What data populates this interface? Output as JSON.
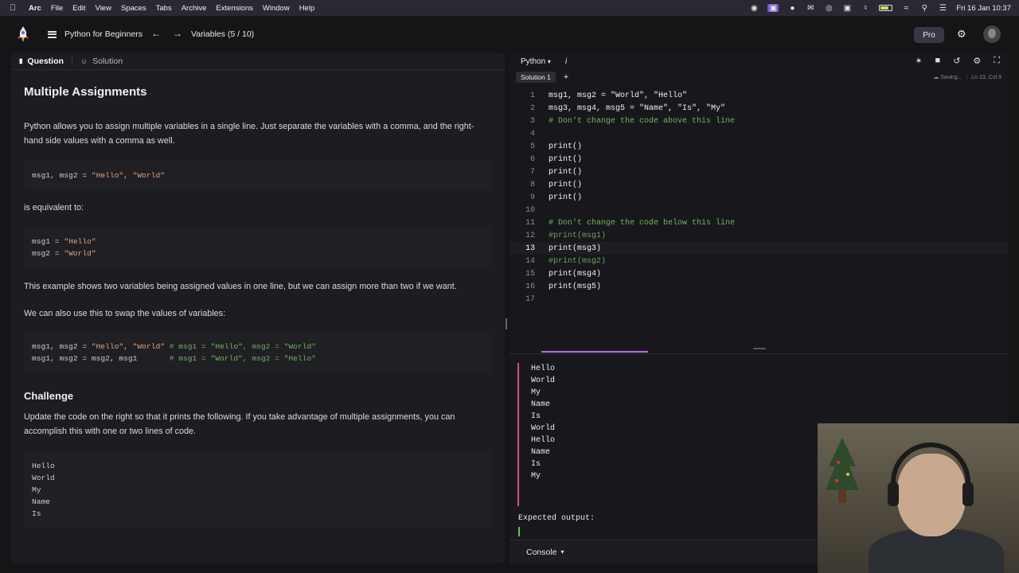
{
  "menubar": {
    "app": "Arc",
    "items": [
      "File",
      "Edit",
      "View",
      "Spaces",
      "Tabs",
      "Archive",
      "Extensions",
      "Window",
      "Help"
    ],
    "clock": "Fri 16 Jan  10:37"
  },
  "topbar": {
    "course": "Python for Beginners",
    "lesson": "Variables (5 / 10)",
    "pro": "Pro"
  },
  "left": {
    "tabs": {
      "question": "Question",
      "solution": "Solution"
    },
    "title": "Multiple Assignments",
    "intro": "Python allows you to assign multiple variables in a single line. Just separate the variables with a comma, and the right-hand side values with a comma as well.",
    "code1": {
      "pre": "msg1, msg2 = ",
      "s1": "\"Hello\"",
      "sep": ", ",
      "s2": "\"World\""
    },
    "equiv": "is equivalent to:",
    "code2": [
      {
        "pre": "msg1 = ",
        "s": "\"Hello\""
      },
      {
        "pre": "msg2 = ",
        "s": "\"World\""
      }
    ],
    "example": "This example shows two variables being assigned values in one line, but we can assign more than two if we want.",
    "swap": "We can also use this to swap the values of variables:",
    "code3": [
      {
        "pre": "msg1, msg2 = ",
        "s1": "\"Hello\"",
        "sep": ", ",
        "s2": "\"World\"",
        "cm": " # msg1 = \"Hello\", msg2 = \"World\""
      },
      {
        "pre": "msg1, msg2 = msg2, msg1      ",
        "cm": " # msg1 = \"World\", msg2 = \"Hello\""
      }
    ],
    "challenge_title": "Challenge",
    "challenge": "Update the code on the right so that it prints the following. If you take advantage of multiple assignments, you can accomplish this with one or two lines of code.",
    "expected_lines": [
      "Hello",
      "World",
      "My",
      "Name",
      "Is"
    ]
  },
  "right": {
    "language": "Python",
    "info": "i",
    "solution_tab": "Solution 1",
    "add": "+",
    "saving": "Saving...",
    "cursor": "Ln 13, Col 9",
    "code_lines": [
      {
        "n": "1",
        "t": "msg1, msg2 = \"World\", \"Hello\"",
        "k": "code"
      },
      {
        "n": "2",
        "t": "msg3, msg4, msg5 = \"Name\", \"Is\", \"My\"",
        "k": "code"
      },
      {
        "n": "3",
        "t": "# Don't change the code above this line",
        "k": "cm"
      },
      {
        "n": "4",
        "t": "",
        "k": "code"
      },
      {
        "n": "5",
        "t": "print()",
        "k": "code"
      },
      {
        "n": "6",
        "t": "print()",
        "k": "code"
      },
      {
        "n": "7",
        "t": "print()",
        "k": "code"
      },
      {
        "n": "8",
        "t": "print()",
        "k": "code"
      },
      {
        "n": "9",
        "t": "print()",
        "k": "code"
      },
      {
        "n": "10",
        "t": "",
        "k": "code"
      },
      {
        "n": "11",
        "t": "# Don't change the code below this line",
        "k": "cm"
      },
      {
        "n": "12",
        "t": "#print(msg1)",
        "k": "dim"
      },
      {
        "n": "13",
        "t": "print(msg3)",
        "k": "code"
      },
      {
        "n": "14",
        "t": "#print(msg2)",
        "k": "dim"
      },
      {
        "n": "15",
        "t": "print(msg4)",
        "k": "code"
      },
      {
        "n": "16",
        "t": "print(msg5)",
        "k": "code"
      },
      {
        "n": "17",
        "t": "",
        "k": "code"
      }
    ],
    "output_lines": [
      "Hello",
      "World",
      "My",
      "Name",
      "Is",
      "World",
      "Hello",
      "Name",
      "Is",
      "My"
    ],
    "expected_label": "Expected output:",
    "console": "Console"
  }
}
